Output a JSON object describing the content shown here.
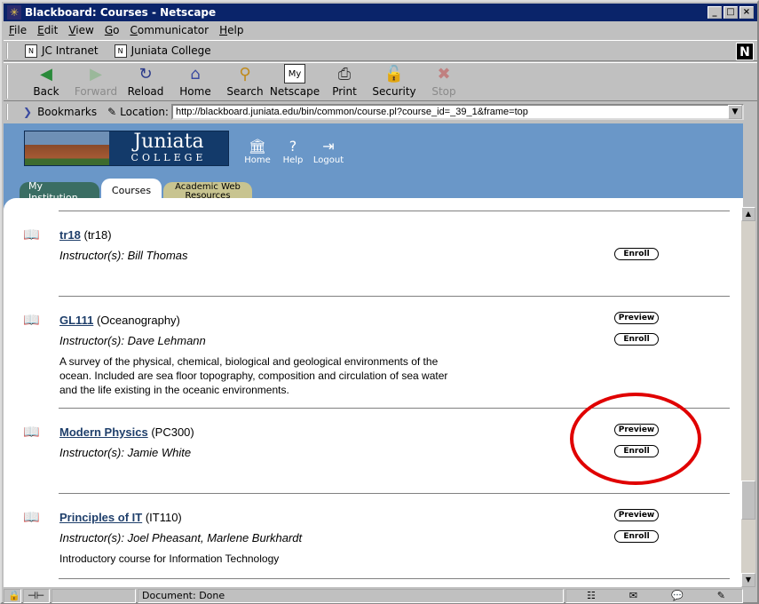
{
  "window": {
    "title": "Blackboard: Courses - Netscape"
  },
  "menu": [
    "File",
    "Edit",
    "View",
    "Go",
    "Communicator",
    "Help"
  ],
  "personal_toolbar": [
    "JC Intranet",
    "Juniata College"
  ],
  "nav_toolbar": [
    {
      "label": "Back",
      "icon": "back-arrow-icon",
      "enabled": true
    },
    {
      "label": "Forward",
      "icon": "forward-arrow-icon",
      "enabled": false
    },
    {
      "label": "Reload",
      "icon": "reload-icon",
      "enabled": true
    },
    {
      "label": "Home",
      "icon": "home-icon",
      "enabled": true
    },
    {
      "label": "Search",
      "icon": "search-icon",
      "enabled": true
    },
    {
      "label": "Netscape",
      "icon": "netscape-icon",
      "enabled": true
    },
    {
      "label": "Print",
      "icon": "print-icon",
      "enabled": true
    },
    {
      "label": "Security",
      "icon": "lock-icon",
      "enabled": true
    },
    {
      "label": "Stop",
      "icon": "stop-icon",
      "enabled": false
    }
  ],
  "location": {
    "bookmarks_label": "Bookmarks",
    "location_label": "Location:",
    "url": "http://blackboard.juniata.edu/bin/common/course.pl?course_id=_39_1&frame=top"
  },
  "site": {
    "logo_name": "Juniata",
    "logo_sub": "COLLEGE",
    "top_links": [
      "Home",
      "Help",
      "Logout"
    ],
    "tabs": [
      {
        "label": "My Institution",
        "active": false
      },
      {
        "label": "Courses",
        "active": true
      },
      {
        "label": "Academic Web Resources",
        "active": false
      }
    ]
  },
  "courses": [
    {
      "link": "tr18",
      "code": "(tr18)",
      "instructor_label": "Instructor(s):",
      "instructor": "Bill Thomas",
      "description": "",
      "buttons": [
        "Enroll"
      ]
    },
    {
      "link": "GL111",
      "code": "(Oceanography)",
      "instructor_label": "Instructor(s):",
      "instructor": "Dave Lehmann",
      "description": "A survey of the physical, chemical, biological and geological environments of the ocean. Included are sea floor topography, composition and circulation of sea water and the life existing in the oceanic environments.",
      "buttons": [
        "Preview",
        "Enroll"
      ]
    },
    {
      "link": "Modern Physics",
      "code": "(PC300)",
      "instructor_label": "Instructor(s):",
      "instructor": "Jamie White",
      "description": "",
      "buttons": [
        "Preview",
        "Enroll"
      ]
    },
    {
      "link": "Principles of IT",
      "code": "(IT110)",
      "instructor_label": "Instructor(s):",
      "instructor": "Joel Pheasant, Marlene Burkhardt",
      "description": "Introductory course for Information Technology",
      "buttons": [
        "Preview",
        "Enroll"
      ]
    }
  ],
  "status": {
    "text": "Document: Done"
  },
  "annotation": {
    "color": "#e00000"
  }
}
